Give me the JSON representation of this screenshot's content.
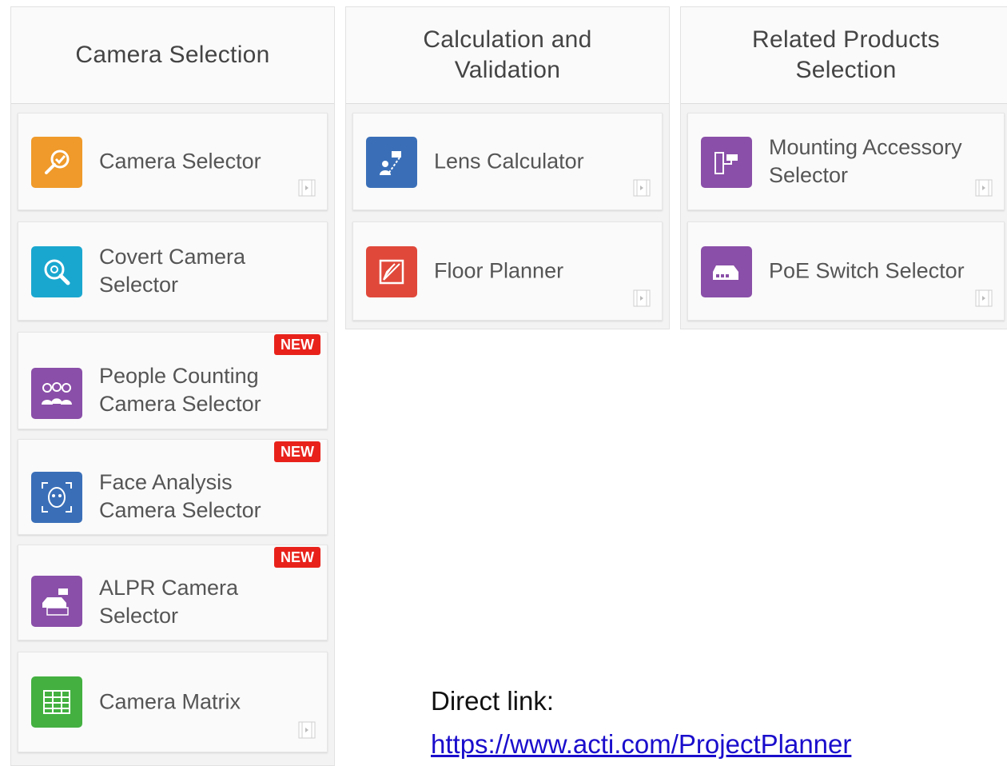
{
  "columns": [
    {
      "title": "Camera Selection",
      "cards": [
        {
          "label": "Camera Selector",
          "icon": "search-check-icon",
          "color": "#ef9a2a",
          "new": false
        },
        {
          "label": "Covert Camera Selector",
          "icon": "magnifier-icon",
          "color": "#1aa7cf",
          "new": false
        },
        {
          "label": "People Counting Camera Selector",
          "icon": "people-icon",
          "color": "#8a4fa8",
          "new": true
        },
        {
          "label": "Face Analysis Camera Selector",
          "icon": "face-icon",
          "color": "#3a6fb8",
          "new": true
        },
        {
          "label": "ALPR Camera Selector",
          "icon": "license-plate-icon",
          "color": "#8a4fa8",
          "new": true
        },
        {
          "label": "Camera Matrix",
          "icon": "table-icon",
          "color": "#43b040",
          "new": false
        }
      ]
    },
    {
      "title": "Calculation and Validation",
      "cards": [
        {
          "label": "Lens Calculator",
          "icon": "lens-calculator-icon",
          "color": "#3a6fb8",
          "new": false
        },
        {
          "label": "Floor Planner",
          "icon": "floor-planner-icon",
          "color": "#e0483a",
          "new": false
        }
      ]
    },
    {
      "title": "Related Products Selection",
      "cards": [
        {
          "label": "Mounting Accessory Selector",
          "icon": "mount-icon",
          "color": "#8a4fa8",
          "new": false
        },
        {
          "label": "PoE Switch Selector",
          "icon": "switch-icon",
          "color": "#8a4fa8",
          "new": false
        }
      ]
    }
  ],
  "badge_label": "NEW",
  "direct_link": {
    "label": "Direct link:",
    "url": "https://www.acti.com/ProjectPlanner"
  }
}
